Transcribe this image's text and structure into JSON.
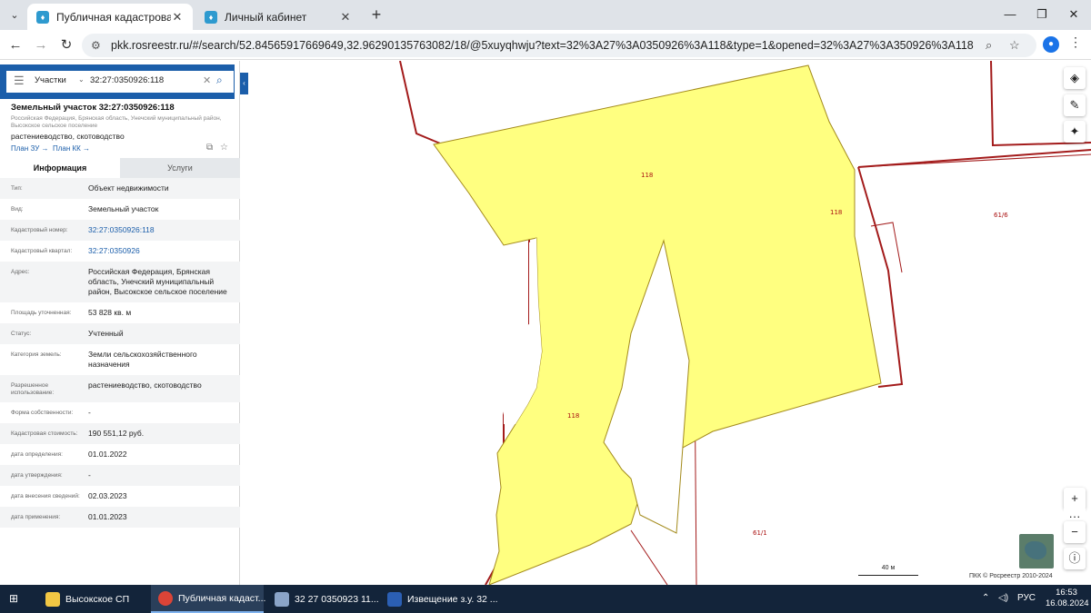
{
  "browser": {
    "tabs": [
      {
        "title": "Публичная кадастровая карта",
        "active": true
      },
      {
        "title": "Личный кабинет",
        "active": false
      }
    ],
    "url": "pkk.rosreestr.ru/#/search/52.84565917669649,32.96290135763082/18/@5xuyqhwju?text=32%3A27%3A0350926%3A118&type=1&opened=32%3A27%3A350926%3A118",
    "profile_initial": "●"
  },
  "panel": {
    "search": {
      "type": "Участки",
      "query": "32:27:0350926:118"
    },
    "title": "Земельный участок 32:27:0350926:118",
    "subtitle": "Российская Федерация, Брянская область, Унечский муниципальный район, Высокское сельское поселение",
    "use": "растениеводство, скотоводство",
    "link_plan_zu": "План ЗУ →",
    "link_plan_kk": "План КК →",
    "tab_info": "Информация",
    "tab_services": "Услуги",
    "rows": [
      {
        "k": "Тип:",
        "v": "Объект недвижимости",
        "link": false
      },
      {
        "k": "Вид:",
        "v": "Земельный участок",
        "link": false
      },
      {
        "k": "Кадастровый номер:",
        "v": "32:27:0350926:118",
        "link": true
      },
      {
        "k": "Кадастровый квартал:",
        "v": "32:27:0350926",
        "link": true
      },
      {
        "k": "Адрес:",
        "v": "Российская Федерация, Брянская область, Унечский муниципальный район, Высокское сельское поселение",
        "link": false
      },
      {
        "k": "Площадь уточненная:",
        "v": "53 828 кв. м",
        "link": false
      },
      {
        "k": "Статус:",
        "v": "Учтенный",
        "link": false
      },
      {
        "k": "Категория земель:",
        "v": "Земли сельскохозяйственного назначения",
        "link": false
      },
      {
        "k": "Разрешенное использование:",
        "v": "растениеводство, скотоводство",
        "link": false
      },
      {
        "k": "Форма собственности:",
        "v": "-",
        "link": false
      },
      {
        "k": "Кадастровая стоимость:",
        "v": "190 551,12 руб.",
        "link": false
      },
      {
        "k": "дата определения:",
        "v": "01.01.2022",
        "link": false
      },
      {
        "k": "дата утверждения:",
        "v": "-",
        "link": false
      },
      {
        "k": "дата внесения сведений:",
        "v": "02.03.2023",
        "link": false
      },
      {
        "k": "дата применения:",
        "v": "01.01.2023",
        "link": false
      }
    ]
  },
  "map": {
    "labels": {
      "parcel_a": "118",
      "parcel_b": "118",
      "parcel_c": "118",
      "neighbor_1": "61/6",
      "neighbor_2": "61/1"
    },
    "scale": "40 м",
    "copyright": "ПКК © Росреестр 2010-2024",
    "parcel_fill": "#ffff80",
    "boundary_color": "#a31b1b"
  },
  "taskbar": {
    "items": [
      {
        "label": "Высокское СП",
        "color": "#f2c744"
      },
      {
        "label": "Публичная кадаст...",
        "color": "#db4437"
      },
      {
        "label": "32  27  0350923  11...",
        "color": "#8aa4c8"
      },
      {
        "label": "Извещение з.у. 32 ...",
        "color": "#2b5fb4"
      }
    ],
    "lang": "РУС",
    "time": "16:53",
    "date": "16.08.2024"
  }
}
